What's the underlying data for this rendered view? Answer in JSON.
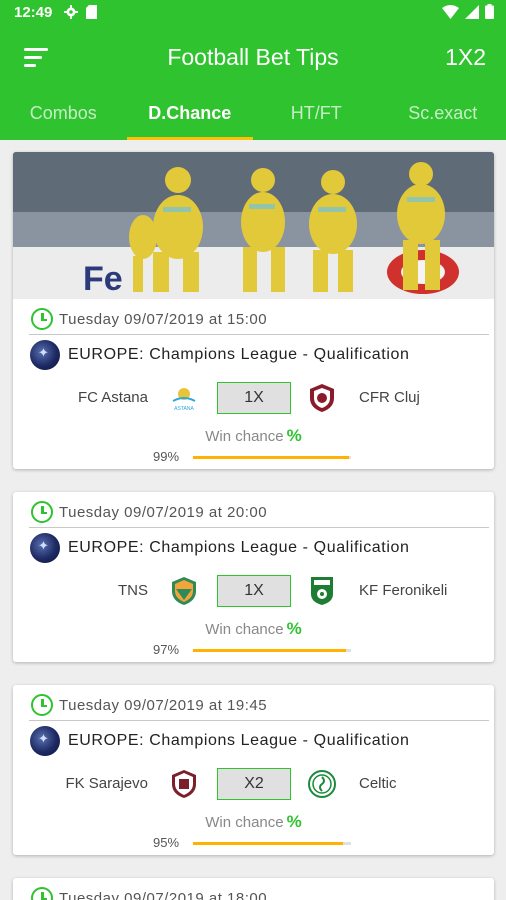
{
  "status_bar": {
    "time": "12:49"
  },
  "app_bar": {
    "title": "Football Bet Tips",
    "action": "1X2"
  },
  "tabs": [
    {
      "label": "Combos",
      "active": false
    },
    {
      "label": "D.Chance",
      "active": true
    },
    {
      "label": "HT/FT",
      "active": false
    },
    {
      "label": "Sc.exact",
      "active": false
    }
  ],
  "colors": {
    "primary": "#2fc32f",
    "indicator": "#ffc107",
    "progress": "#ffb300"
  },
  "matches": [
    {
      "date": "Tuesday 09/07/2019 at 15:00",
      "league": "EUROPE: Champions League - Qualification",
      "home": "FC Astana",
      "away": "CFR Cluj",
      "tip": "1X",
      "chance_label": "Win chance",
      "chance_symbol": "%",
      "probability": "99%",
      "probability_value": 99,
      "home_logo": "astana-logo",
      "away_logo": "cfr-cluj-logo"
    },
    {
      "date": "Tuesday 09/07/2019 at 20:00",
      "league": "EUROPE: Champions League - Qualification",
      "home": "TNS",
      "away": "KF Feronikeli",
      "tip": "1X",
      "chance_label": "Win chance",
      "chance_symbol": "%",
      "probability": "97%",
      "probability_value": 97,
      "home_logo": "tns-logo",
      "away_logo": "feronikeli-logo"
    },
    {
      "date": "Tuesday 09/07/2019 at 19:45",
      "league": "EUROPE: Champions League - Qualification",
      "home": "FK Sarajevo",
      "away": "Celtic",
      "tip": "X2",
      "chance_label": "Win chance",
      "chance_symbol": "%",
      "probability": "95%",
      "probability_value": 95,
      "home_logo": "sarajevo-logo",
      "away_logo": "celtic-logo"
    },
    {
      "date": "Tuesday 09/07/2019 at 18:00"
    }
  ]
}
